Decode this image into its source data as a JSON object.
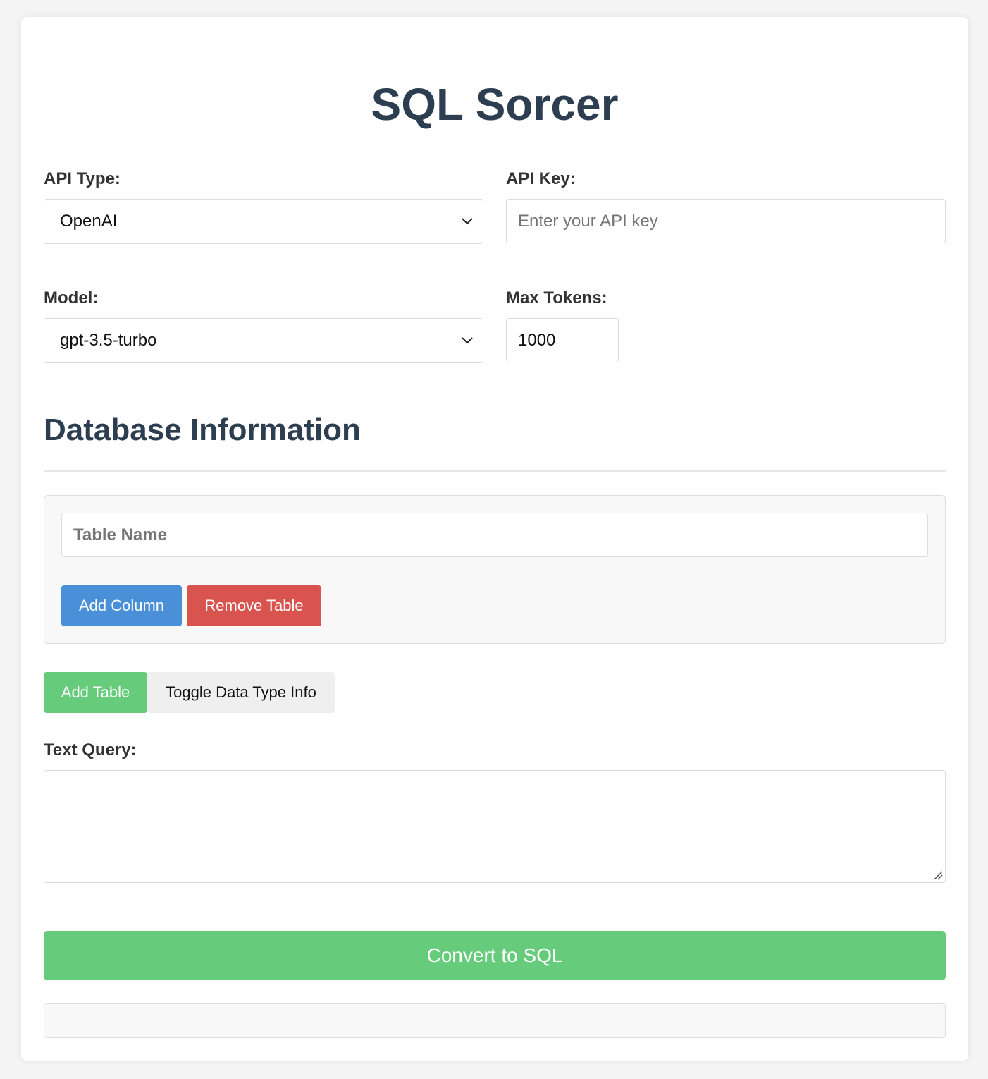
{
  "app": {
    "title": "SQL Sorcer"
  },
  "settings": {
    "api_type": {
      "label": "API Type:",
      "value": "OpenAI"
    },
    "api_key": {
      "label": "API Key:",
      "placeholder": "Enter your API key",
      "value": ""
    },
    "model": {
      "label": "Model:",
      "value": "gpt-3.5-turbo"
    },
    "max_tokens": {
      "label": "Max Tokens:",
      "value": "1000"
    }
  },
  "database": {
    "section_title": "Database Information",
    "tables": [
      {
        "name_placeholder": "Table Name",
        "add_column_label": "Add Column",
        "remove_table_label": "Remove Table"
      }
    ],
    "add_table_label": "Add Table",
    "toggle_data_type_label": "Toggle Data Type Info"
  },
  "query": {
    "label": "Text Query:",
    "value": ""
  },
  "convert_button_label": "Convert to SQL",
  "result": {
    "text": ""
  },
  "colors": {
    "heading": "#2c3e50",
    "blue_button": "#4a90d9",
    "red_button": "#d9534f",
    "green_button": "#66cb7b",
    "grey_button": "#efefef"
  },
  "icons": {
    "select_arrow": "chevron-down-icon",
    "textarea_resize": "resize-grip-icon"
  }
}
